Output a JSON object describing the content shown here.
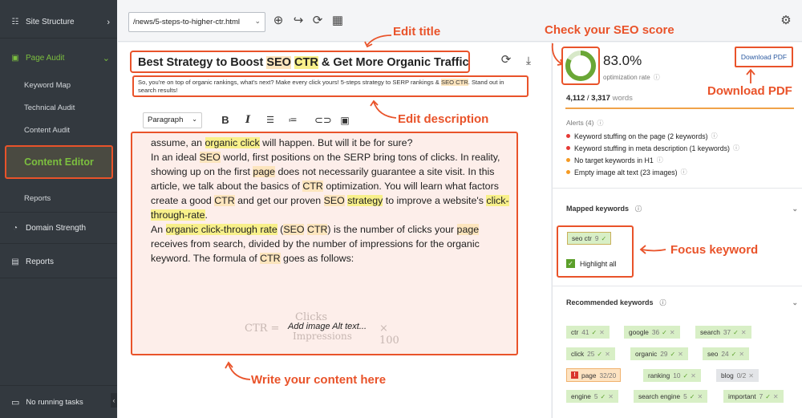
{
  "sidebar": {
    "site_structure": "Site Structure",
    "page_audit": "Page Audit",
    "keyword_map": "Keyword Map",
    "technical_audit": "Technical Audit",
    "content_audit": "Content Audit",
    "content_editor": "Content Editor",
    "reports_sub": "Reports",
    "domain_strength": "Domain Strength",
    "reports": "Reports",
    "footer": "No running tasks"
  },
  "topbar": {
    "url_value": "/news/5-steps-to-higher-ctr.html"
  },
  "editor": {
    "title_parts": [
      "Best Strategy to Boost ",
      "SEO",
      " ",
      "CTR",
      " & Get More Organic Traffic"
    ],
    "desc_parts": [
      "So, you're on top of organic rankings, what's next? Make every click yours! 5-steps strategy to SERP rankings & ",
      "SEO CTR",
      ". Stand out in search results!"
    ],
    "paragraph_select": "Paragraph",
    "formula_num": "Clicks",
    "formula_den": "Impressions",
    "formula_left": "CTR =",
    "formula_right": "× 100",
    "alt_text": "Add image Alt text..."
  },
  "callouts": {
    "edit_title": "Edit title",
    "check_score": "Check your SEO score",
    "edit_description": "Edit description",
    "download_pdf": "Download PDF",
    "focus_keyword": "Focus keyword",
    "write_content": "Write your content here"
  },
  "score": {
    "value": "83.0%",
    "value_fraction": 0.83,
    "label": "optimization rate",
    "download_btn": "Download PDF",
    "words_current": "4,112",
    "words_sep": " / ",
    "words_target": "3,317",
    "words_label": "words"
  },
  "alerts": {
    "header": "Alerts (4)",
    "items": [
      {
        "text": "Keyword stuffing on the page (2 keywords)",
        "color": "#e53935"
      },
      {
        "text": "Keyword stuffing in meta description (1 keywords)",
        "color": "#e53935"
      },
      {
        "text": "No target keywords in H1",
        "color": "#f59a23"
      },
      {
        "text": "Empty image alt text (23 images)",
        "color": "#f59a23"
      }
    ]
  },
  "mapped": {
    "header": "Mapped keywords",
    "keyword": "seo ctr",
    "count": "9",
    "highlight_label": "Highlight all"
  },
  "recommended": {
    "header": "Recommended keywords",
    "items": [
      {
        "kw": "ctr",
        "count": "41"
      },
      {
        "kw": "google",
        "count": "36"
      },
      {
        "kw": "search",
        "count": "37"
      },
      {
        "kw": "click",
        "count": "25"
      },
      {
        "kw": "organic",
        "count": "29"
      },
      {
        "kw": "seo",
        "count": "24"
      },
      {
        "kw": "page",
        "count": "32/20"
      },
      {
        "kw": "ranking",
        "count": "10"
      },
      {
        "kw": "blog",
        "count": "0/2"
      },
      {
        "kw": "engine",
        "count": "5"
      },
      {
        "kw": "search engine",
        "count": "5"
      },
      {
        "kw": "important",
        "count": "7"
      }
    ]
  },
  "colors": {
    "accent": "#e9532a",
    "sidebar_bg": "#33393f",
    "active_green": "#7cbf3f",
    "keyword_green": "#d8efc6",
    "highlight_yellow": "#f8f08a",
    "highlight_orange": "#fde5bd"
  }
}
